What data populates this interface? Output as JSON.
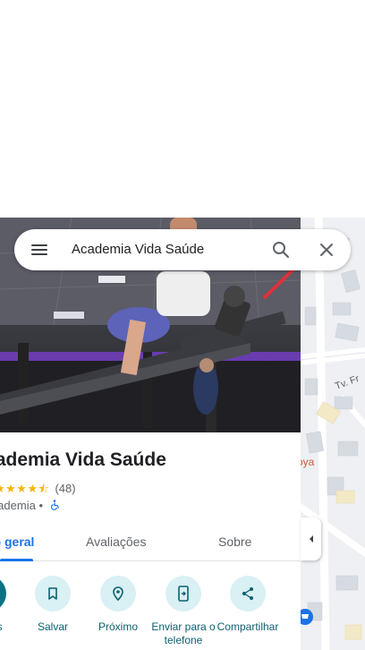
{
  "search": {
    "query": "Academia Vida Saúde"
  },
  "place": {
    "name": "Academia Vida Saúde",
    "stars_display": "★★★★⯪",
    "rating_count": "(48)",
    "category": "Academia",
    "category_separator": "•"
  },
  "tabs": [
    {
      "label": "Visão geral",
      "active": true
    },
    {
      "label": "Avaliações",
      "active": false
    },
    {
      "label": "Sobre",
      "active": false
    }
  ],
  "actions": [
    {
      "label": "Rotas",
      "icon": "directions-icon"
    },
    {
      "label": "Salvar",
      "icon": "bookmark-icon"
    },
    {
      "label": "Próximo",
      "icon": "nearby-icon"
    },
    {
      "label": "Enviar para o telefone",
      "icon": "send-to-phone-icon"
    },
    {
      "label": "Compartilhar",
      "icon": "share-icon"
    }
  ],
  "map": {
    "street_label": "Tv. Fr",
    "vertical_label": "lio",
    "poi_label": "oya"
  },
  "colors": {
    "accent": "#1a73e8",
    "action_tint": "#d9f0f4",
    "action_text": "#0b6170",
    "stars": "#f4b400"
  }
}
